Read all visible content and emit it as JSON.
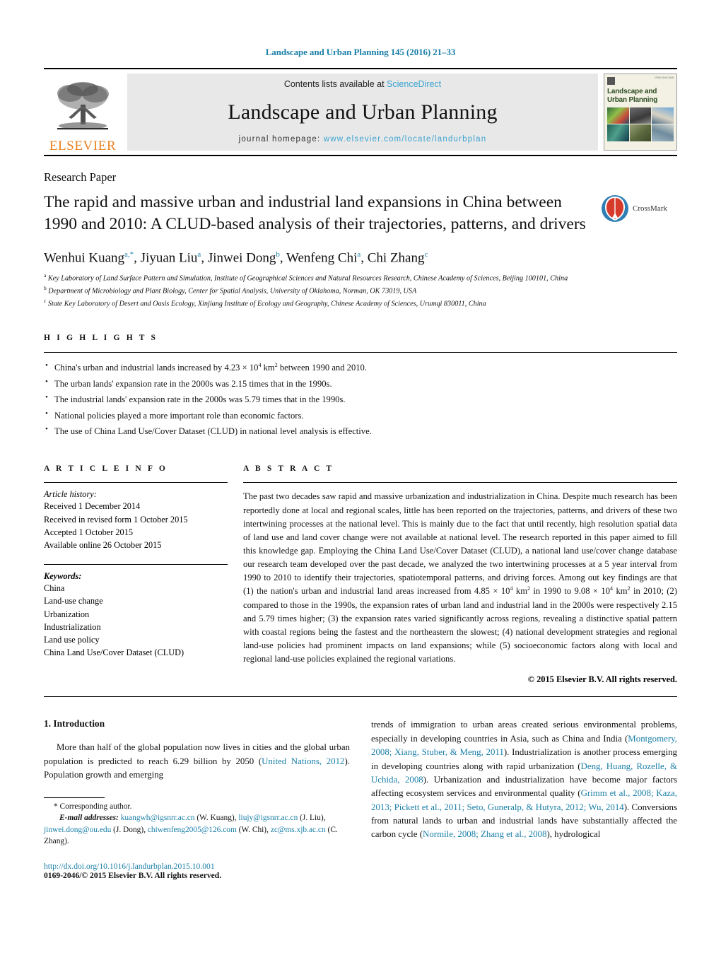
{
  "running_head": "Landscape and Urban Planning 145 (2016) 21–33",
  "masthead": {
    "contents_prefix": "Contents lists available at ",
    "sciencedirect": "ScienceDirect",
    "journal_title": "Landscape and Urban Planning",
    "homepage_prefix": "journal homepage:",
    "homepage_url": "www.elsevier.com/locate/landurbplan",
    "publisher_logo_text": "ELSEVIER",
    "cover": {
      "name_line1": "Landscape and",
      "name_line2": "Urban Planning"
    },
    "accent_link_color": "#3ba3d0"
  },
  "article": {
    "type": "Research Paper",
    "title": "The rapid and massive urban and industrial land expansions in China between 1990 and 2010: A CLUD-based analysis of their trajectories, patterns, and drivers",
    "crossmark_label": "CrossMark",
    "authors_html": "Wenhui Kuang<sup>a,*</sup>, Jiyuan Liu<sup>a</sup>, Jinwei Dong<sup>b</sup>, Wenfeng Chi<sup>a</sup>, Chi Zhang<sup>c</sup>",
    "affiliations": [
      "Key Laboratory of Land Surface Pattern and Simulation, Institute of Geographical Sciences and Natural Resources Research, Chinese Academy of Sciences, Beijing 100101, China",
      "Department of Microbiology and Plant Biology, Center for Spatial Analysis, University of Oklahoma, Norman, OK 73019, USA",
      "State Key Laboratory of Desert and Oasis Ecology, Xinjiang Institute of Ecology and Geography, Chinese Academy of Sciences, Urumqi 830011, China"
    ],
    "affiliation_markers": [
      "a",
      "b",
      "c"
    ]
  },
  "highlights": {
    "label": "H I G H L I G H T S",
    "items_html": [
      "China's urban and industrial lands increased by 4.23 × 10<sup class=\"sm\">4</sup> km<sup class=\"sm\">2</sup> between 1990 and 2010.",
      "The urban lands' expansion rate in the 2000s was 2.15 times that in the 1990s.",
      "The industrial lands' expansion rate in the 2000s was 5.79 times that in the 1990s.",
      "National policies played a more important role than economic factors.",
      "The use of China Land Use/Cover Dataset (CLUD) in national level analysis is effective."
    ]
  },
  "article_info": {
    "label": "A R T I C L E    I N F O",
    "history_title": "Article history:",
    "history": [
      "Received 1 December 2014",
      "Received in revised form 1 October 2015",
      "Accepted 1 October 2015",
      "Available online 26 October 2015"
    ],
    "keywords_title": "Keywords:",
    "keywords": [
      "China",
      "Land-use change",
      "Urbanization",
      "Industrialization",
      "Land use policy",
      "China Land Use/Cover Dataset (CLUD)"
    ]
  },
  "abstract": {
    "label": "A B S T R A C T",
    "text_html": "The past two decades saw rapid and massive urbanization and industrialization in China. Despite much research has been reportedly done at local and regional scales, little has been reported on the trajectories, patterns, and drivers of these two intertwining processes at the national level. This is mainly due to the fact that until recently, high resolution spatial data of land use and land cover change were not available at national level. The research reported in this paper aimed to fill this knowledge gap. Employing the China Land Use/Cover Dataset (CLUD), a national land use/cover change database our research team developed over the past decade, we analyzed the two intertwining processes at a 5 year interval from 1990 to 2010 to identify their trajectories, spatiotemporal patterns, and driving forces. Among out key findings are that (1) the nation's urban and industrial land areas increased from 4.85 × 10<sup class=\"sm\">4</sup> km<sup class=\"sm\">2</sup> in 1990 to 9.08 × 10<sup class=\"sm\">4</sup> km<sup class=\"sm\">2</sup> in 2010; (2) compared to those in the 1990s, the expansion rates of urban land and industrial land in the 2000s were respectively 2.15 and 5.79 times higher; (3) the expansion rates varied significantly across regions, revealing a distinctive spatial pattern with coastal regions being the fastest and the northeastern the slowest; (4) national development strategies and regional land-use policies had prominent impacts on land expansions; while (5) socioeconomic factors along with local and regional land-use policies explained the regional variations.",
    "copyright": "© 2015 Elsevier B.V. All rights reserved."
  },
  "body": {
    "section_heading": "1.  Introduction",
    "left_paragraph_html": "More than half of the global population now lives in cities and the global urban population is predicted to reach 6.29 billion by 2050 (<span class=\"ref\">United Nations, 2012</span>). Population growth and emerging",
    "right_paragraph_html": "trends of immigration to urban areas created serious environmental problems, especially in developing countries in Asia, such as China and India (<span class=\"ref\">Montgomery, 2008; Xiang, Stuber, &amp; Meng, 2011</span>). Industrialization is another process emerging in developing countries along with rapid urbanization (<span class=\"ref\">Deng, Huang, Rozelle, &amp; Uchida, 2008</span>). Urbanization and industrialization have become major factors affecting ecosystem services and environmental quality (<span class=\"ref\">Grimm et al., 2008; Kaza, 2013; Pickett et al., 2011; Seto, Guneralp, &amp; Hutyra, 2012; Wu, 2014</span>). Conversions from natural lands to urban and industrial lands have substantially affected the carbon cycle (<span class=\"ref\">Normile, 2008; Zhang et al., 2008</span>), hydrological"
  },
  "footnote": {
    "corresponding": "*  Corresponding author.",
    "email_label": "E-mail addresses:",
    "emails_html": "<span class=\"ref\">kuangwh@igsnrr.ac.cn</span> (W. Kuang), <span class=\"ref\">liujy@igsnrr.ac.cn</span> (J. Liu), <span class=\"ref\">jinwei.dong@ou.edu</span> (J. Dong), <span class=\"ref\">chiwenfeng2005@126.com</span> (W. Chi), <span class=\"ref\">zc@ms.xjb.ac.cn</span> (C. Zhang).",
    "doi": "http://dx.doi.org/10.1016/j.landurbplan.2015.10.001",
    "issn": "0169-2046/© 2015 Elsevier B.V. All rights reserved."
  }
}
